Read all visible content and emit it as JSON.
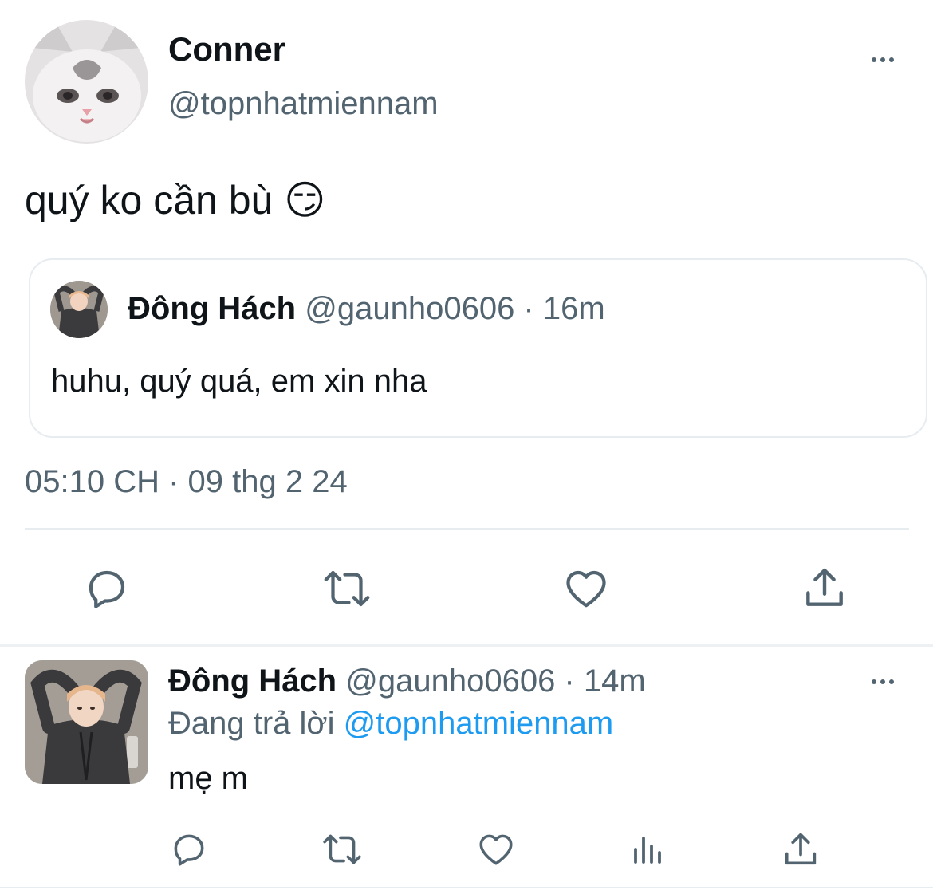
{
  "main_tweet": {
    "author_name": "Conner",
    "author_handle": "@topnhatmiennam",
    "text": "quý ko cần bù",
    "emoji": "😏",
    "timestamp": "05:10 CH · 09 thg 2 24",
    "avatar": "cat-avatar"
  },
  "quoted_tweet": {
    "author_name": "Đông Hách",
    "meta": "@gaunho0606 · 16m",
    "text": "huhu, quý quá, em xin nha",
    "avatar": "person-heart-pose-avatar"
  },
  "main_actions": [
    "reply-icon",
    "retweet-icon",
    "like-icon",
    "share-icon"
  ],
  "reply_tweet": {
    "author_name": "Đông Hách",
    "meta": "@gaunho0606 · 14m",
    "replying_label": "Đang trả lời",
    "replying_to": "@topnhatmiennam",
    "text": "mẹ m",
    "avatar": "person-heart-pose-avatar"
  },
  "reply_actions": [
    "reply-icon",
    "retweet-icon",
    "like-icon",
    "analytics-icon",
    "share-icon"
  ],
  "colors": {
    "accent": "#1d9bf0",
    "text": "#0f1419",
    "secondary": "#536471",
    "divider": "#e6ecf0"
  }
}
